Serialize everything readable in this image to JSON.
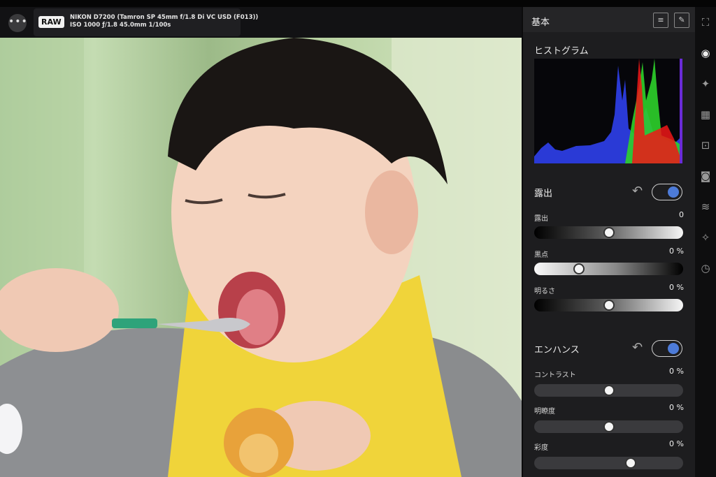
{
  "photo": {
    "raw_badge": "RAW",
    "exif_line1": "NIKON D7200 (Tamron SP 45mm f/1.8 Di VC USD (F013))",
    "exif_line2": "ISO 1000 ƒ/1.8 45.0mm 1/100s"
  },
  "toolbar": {
    "more_glyph": "•••"
  },
  "panel": {
    "title": "基本",
    "header_icons": [
      "list-icon",
      "pin-icon"
    ],
    "histogram_label": "ヒストグラム",
    "exposure": {
      "label": "露出",
      "enabled": true,
      "sliders": [
        {
          "label": "露出",
          "value": "0",
          "fraction": 0.5
        },
        {
          "label": "黒点",
          "value": "0 %",
          "fraction": 0.3
        },
        {
          "label": "明るさ",
          "value": "0 %",
          "fraction": 0.5
        }
      ]
    },
    "enhance": {
      "label": "エンハンス",
      "enabled": true,
      "sliders": [
        {
          "label": "コントラスト",
          "value": "0 %",
          "fraction": 0.5
        },
        {
          "label": "明瞭度",
          "value": "0 %",
          "fraction": 0.5
        },
        {
          "label": "彩度",
          "value": "0 %",
          "fraction": 0.65
        }
      ]
    }
  },
  "rail": {
    "icons": [
      "crop-icon",
      "color-wheel-icon",
      "vignette-icon",
      "noise-icon",
      "lens-icon",
      "camera-icon",
      "layers-icon",
      "retouch-icon",
      "history-icon"
    ]
  },
  "colors": {
    "accent": "#4d7bd8",
    "panel_bg": "#1d1d1f"
  }
}
